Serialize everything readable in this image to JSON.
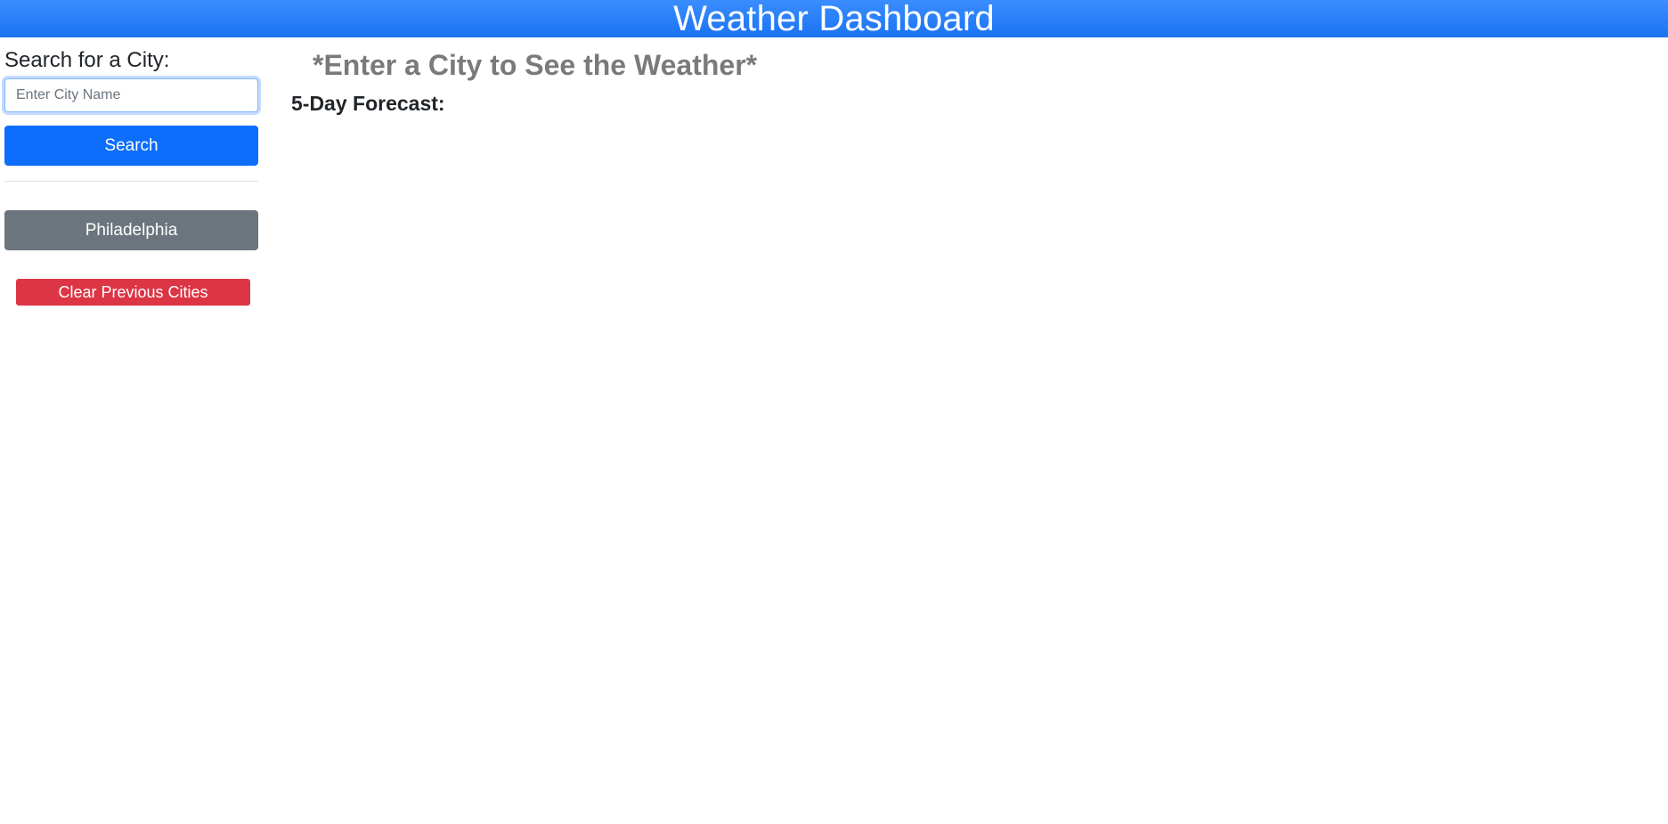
{
  "header": {
    "title": "Weather Dashboard"
  },
  "sidebar": {
    "search_label": "Search for a City:",
    "search_placeholder": "Enter City Name",
    "search_value": "",
    "search_button": "Search",
    "previous_cities": [
      "Philadelphia"
    ],
    "clear_button": "Clear Previous Cities"
  },
  "main": {
    "prompt": "*Enter a City to See the Weather*",
    "forecast_title": "5-Day Forecast:"
  },
  "colors": {
    "header": "#1a73f2",
    "search_button": "#0d6efd",
    "city_button": "#6c757d",
    "clear_button": "#dc3545",
    "prompt_text": "#7a7a7a"
  }
}
